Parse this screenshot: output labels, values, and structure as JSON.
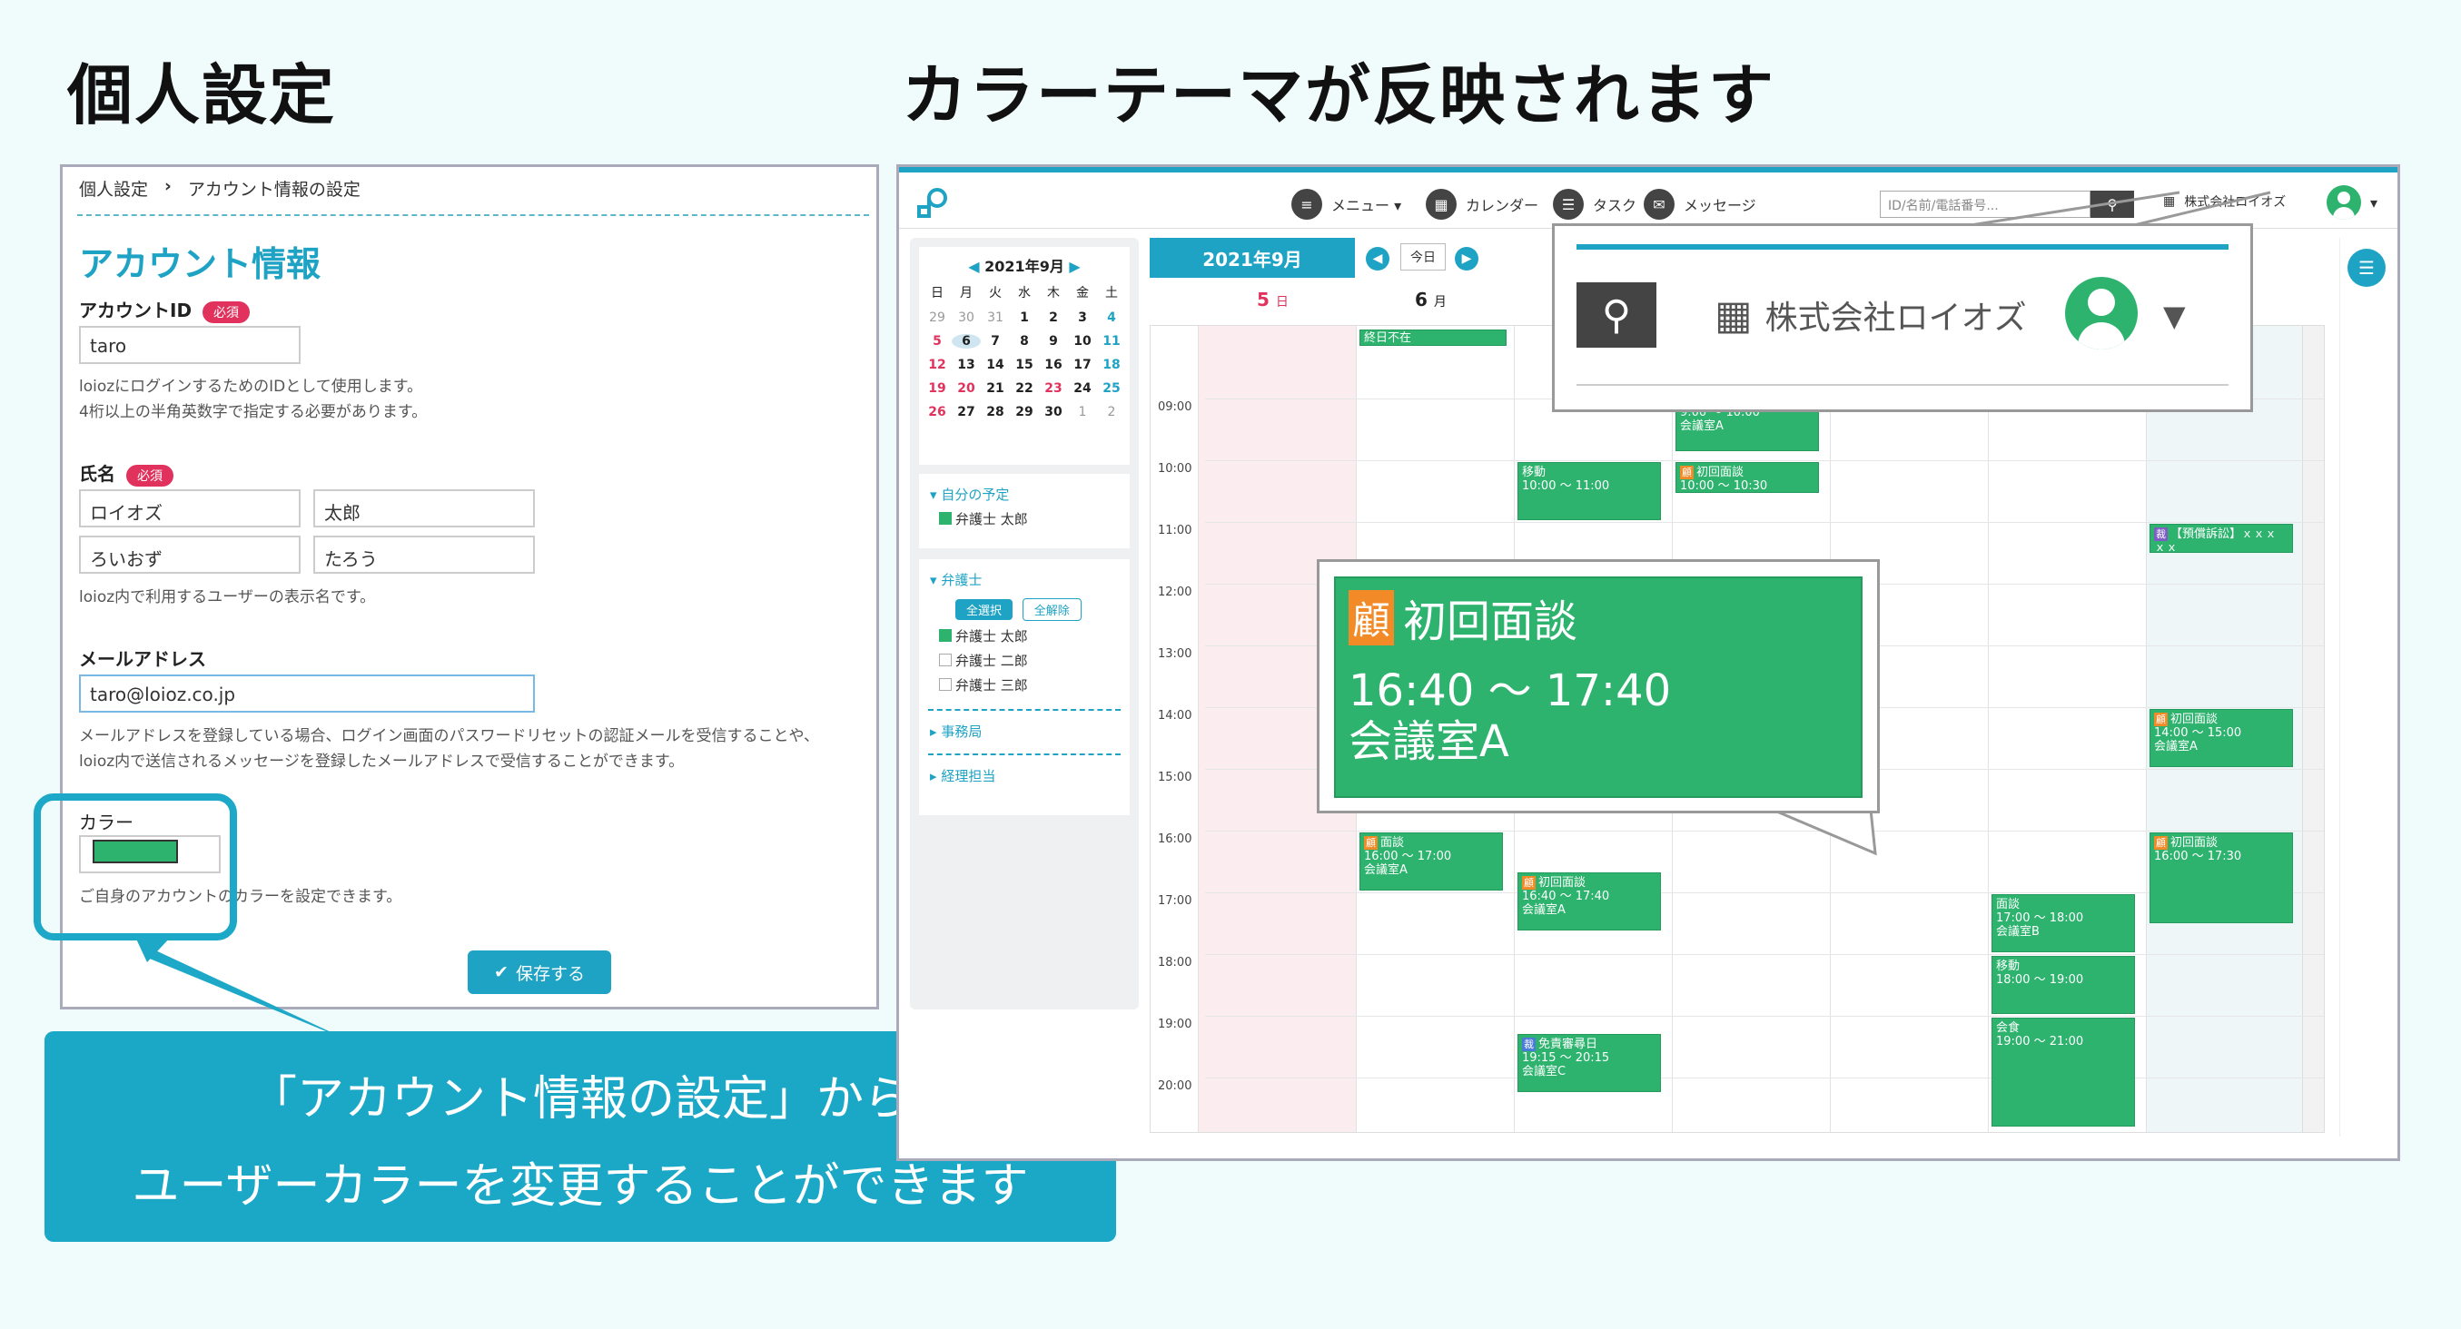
{
  "headings": {
    "left": "個人設定",
    "right": "カラーテーマが反映されます"
  },
  "settings": {
    "breadcrumb": [
      "個人設定",
      "›",
      "アカウント情報の設定"
    ],
    "title": "アカウント情報",
    "account_id_label": "アカウントID",
    "required_label": "必須",
    "account_id_value": "taro",
    "account_id_hint_1": "loiozにログインするためのIDとして使用します。",
    "account_id_hint_2": "4桁以上の半角英数字で指定する必要があります。",
    "name_label": "氏名",
    "last_name": "ロイオズ",
    "first_name": "太郎",
    "last_name_kana": "ろいおず",
    "first_name_kana": "たろう",
    "name_hint": "loioz内で利用するユーザーの表示名です。",
    "email_label": "メールアドレス",
    "email_value": "taro@loioz.co.jp",
    "email_hint_1": "メールアドレスを登録している場合、ログイン画面のパスワードリセットの認証メールを受信することや、",
    "email_hint_2": "loioz内で送信されるメッセージを登録したメールアドレスで受信することができます。",
    "color_label": "カラー",
    "color_value": "#2db36e",
    "color_hint": "ご自身のアカウントのカラーを設定できます。",
    "save_label": "保存する"
  },
  "banner": {
    "line1": "「アカウント情報の設定」から",
    "line2": "ユーザーカラーを変更することができます"
  },
  "app": {
    "nav": [
      {
        "icon": "menu-icon",
        "label": "メニュー ▾"
      },
      {
        "icon": "calendar-icon",
        "label": "カレンダー"
      },
      {
        "icon": "task-icon",
        "label": "タスク"
      },
      {
        "icon": "message-icon",
        "label": "メッセージ"
      }
    ],
    "search_placeholder": "ID/名前/電話番号...",
    "company": "株式会社ロイオズ",
    "mini_calendar": {
      "title": "2021年9月",
      "weekdays": [
        "日",
        "月",
        "火",
        "水",
        "木",
        "金",
        "土"
      ],
      "weeks": [
        [
          "29",
          "30",
          "31",
          "1",
          "2",
          "3",
          "4"
        ],
        [
          "5",
          "6",
          "7",
          "8",
          "9",
          "10",
          "11"
        ],
        [
          "12",
          "13",
          "14",
          "15",
          "16",
          "17",
          "18"
        ],
        [
          "19",
          "20",
          "21",
          "22",
          "23",
          "24",
          "25"
        ],
        [
          "26",
          "27",
          "28",
          "29",
          "30",
          "1",
          "2"
        ]
      ]
    },
    "my_schedule_header": "自分の予定",
    "my_schedule_item": "弁護士 太郎",
    "lawyers_header": "弁護士",
    "select_all": "全選択",
    "deselect_all": "全解除",
    "lawyers": [
      "弁護士 太郎",
      "弁護士 二郎",
      "弁護士 三郎"
    ],
    "office_header": "事務局",
    "accounting_header": "経理担当",
    "calendar_title": "2021年9月",
    "today_label": "今日",
    "day5": "5",
    "day5_w": "日",
    "day6": "6",
    "day6_w": "月",
    "times": [
      "09:00",
      "10:00",
      "11:00",
      "12:00",
      "13:00",
      "14:00",
      "15:00",
      "16:00",
      "17:00",
      "18:00",
      "19:00",
      "20:00"
    ],
    "events": {
      "allday": "終日不在",
      "e1_title": "9:00 ～ 10:00",
      "e1_room": "会議室A",
      "e2_title": "移動",
      "e2_time": "10:00 ～ 11:00",
      "e3_title": "初回面談",
      "e3_time": "10:00 ～ 10:30",
      "e4_title": "【預償訴訟】ｘｘｘ",
      "e4_time": "ｘｘ",
      "e5_title": "初回面談",
      "e5_time": "14:00 ～ 15:00",
      "e5_room": "会議室A",
      "e6_title": "面談",
      "e6_time": "16:00 ～ 17:00",
      "e6_room": "会議室A",
      "e7_title": "初回面談",
      "e7_time": "16:40 ～ 17:40",
      "e7_room": "会議室A",
      "e8_title": "初回面談",
      "e8_time": "16:00 ～ 17:30",
      "e9_title": "面談",
      "e9_time": "17:00 ～ 18:00",
      "e9_room": "会議室B",
      "e10_title": "移動",
      "e10_time": "18:00 ～ 19:00",
      "e11_title": "会食",
      "e11_time": "19:00 ～ 21:00",
      "e12_title": "免責審尋日",
      "e12_time": "19:15 ～ 20:15",
      "e12_room": "会議室C",
      "tag_meeting": "顧",
      "tag_court": "裁"
    }
  },
  "zoom_top": {
    "company": "株式会社ロイオズ"
  },
  "zoom_event": {
    "tag": "顧",
    "title": "初回面談",
    "time": "16:40 ～ 17:40",
    "room": "会議室A"
  }
}
